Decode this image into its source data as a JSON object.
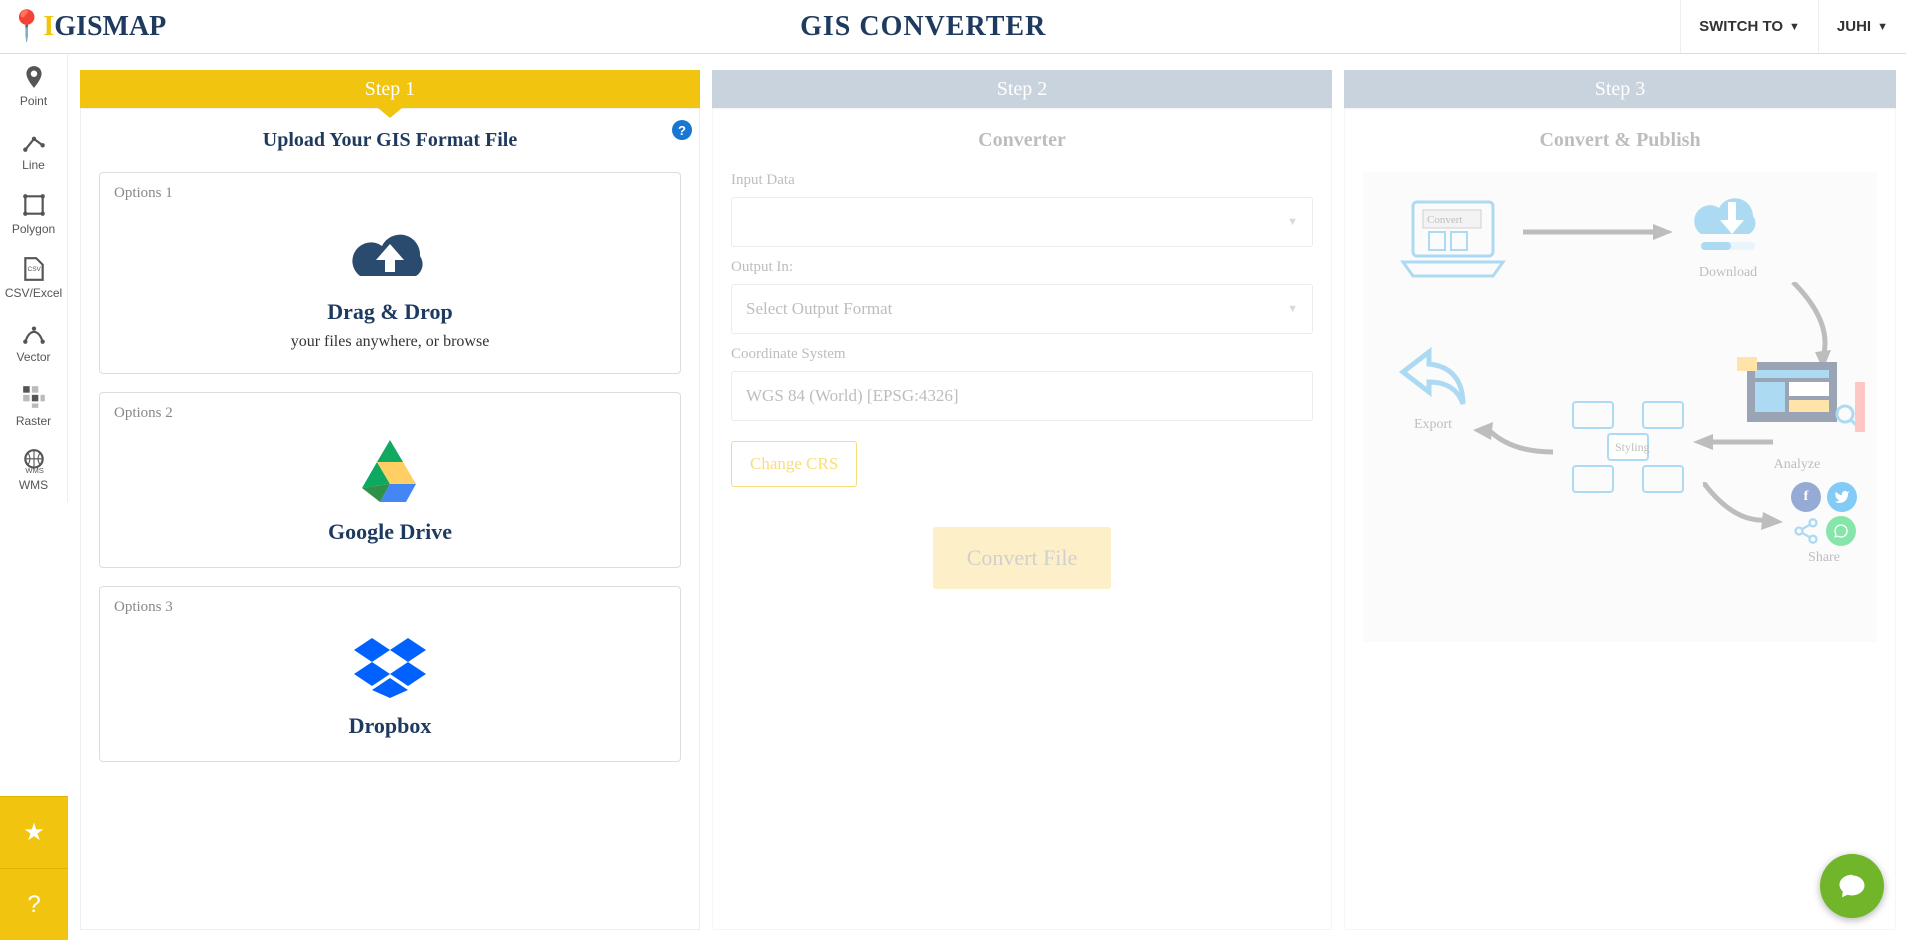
{
  "header": {
    "brand_i": "I",
    "brand_rest": "GISMAP",
    "title": "GIS CONVERTER",
    "switch_to": "SWITCH TO",
    "user": "JUHI"
  },
  "sidebar": {
    "items": [
      {
        "label": "Point"
      },
      {
        "label": "Line"
      },
      {
        "label": "Polygon"
      },
      {
        "label": "CSV/Excel"
      },
      {
        "label": "Vector"
      },
      {
        "label": "Raster"
      },
      {
        "label": "WMS"
      }
    ]
  },
  "steps": {
    "s1": "Step 1",
    "s2": "Step 2",
    "s3": "Step 3"
  },
  "step1": {
    "title": "Upload Your GIS Format File",
    "options": [
      {
        "label": "Options 1",
        "title": "Drag & Drop",
        "sub": "your files anywhere, or browse"
      },
      {
        "label": "Options 2",
        "title": "Google Drive",
        "sub": ""
      },
      {
        "label": "Options 3",
        "title": "Dropbox",
        "sub": ""
      }
    ]
  },
  "step2": {
    "title": "Converter",
    "input_data_label": "Input Data",
    "input_data_value": "",
    "output_label": "Output In:",
    "output_placeholder": "Select Output Format",
    "crs_label": "Coordinate System",
    "crs_value": "WGS 84 (World) [EPSG:4326]",
    "change_crs": "Change CRS",
    "convert_btn": "Convert File"
  },
  "step3": {
    "title": "Convert & Publish",
    "nodes": {
      "convert": "Convert",
      "download": "Download",
      "analyze": "Analyze",
      "styling": "Styling",
      "export": "Export",
      "share": "Share"
    }
  }
}
